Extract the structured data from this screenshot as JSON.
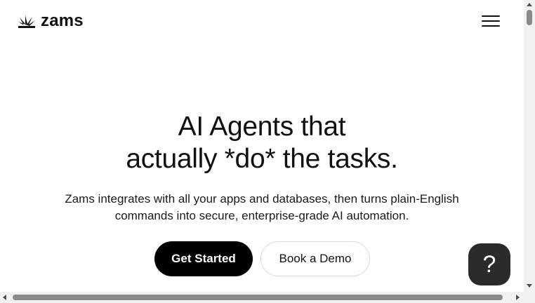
{
  "header": {
    "logo_text": "zams",
    "logo_icon": "zams-logo-mark-icon",
    "menu_icon": "hamburger-menu-icon"
  },
  "hero": {
    "headline_line1": "AI Agents that",
    "headline_line2": "actually *do* the tasks.",
    "subtitle_line1": "Zams integrates with all your apps and databases, then turns plain-English",
    "subtitle_line2": "commands into secure, enterprise-grade AI automation."
  },
  "buttons": {
    "primary_label": "Get Started",
    "secondary_label": "Book a Demo"
  },
  "help": {
    "glyph": "?",
    "icon": "help-question-icon"
  },
  "colors": {
    "primary_button_bg": "#000000",
    "help_button_bg": "#2b2b2b",
    "page_bg": "#ffffff"
  }
}
